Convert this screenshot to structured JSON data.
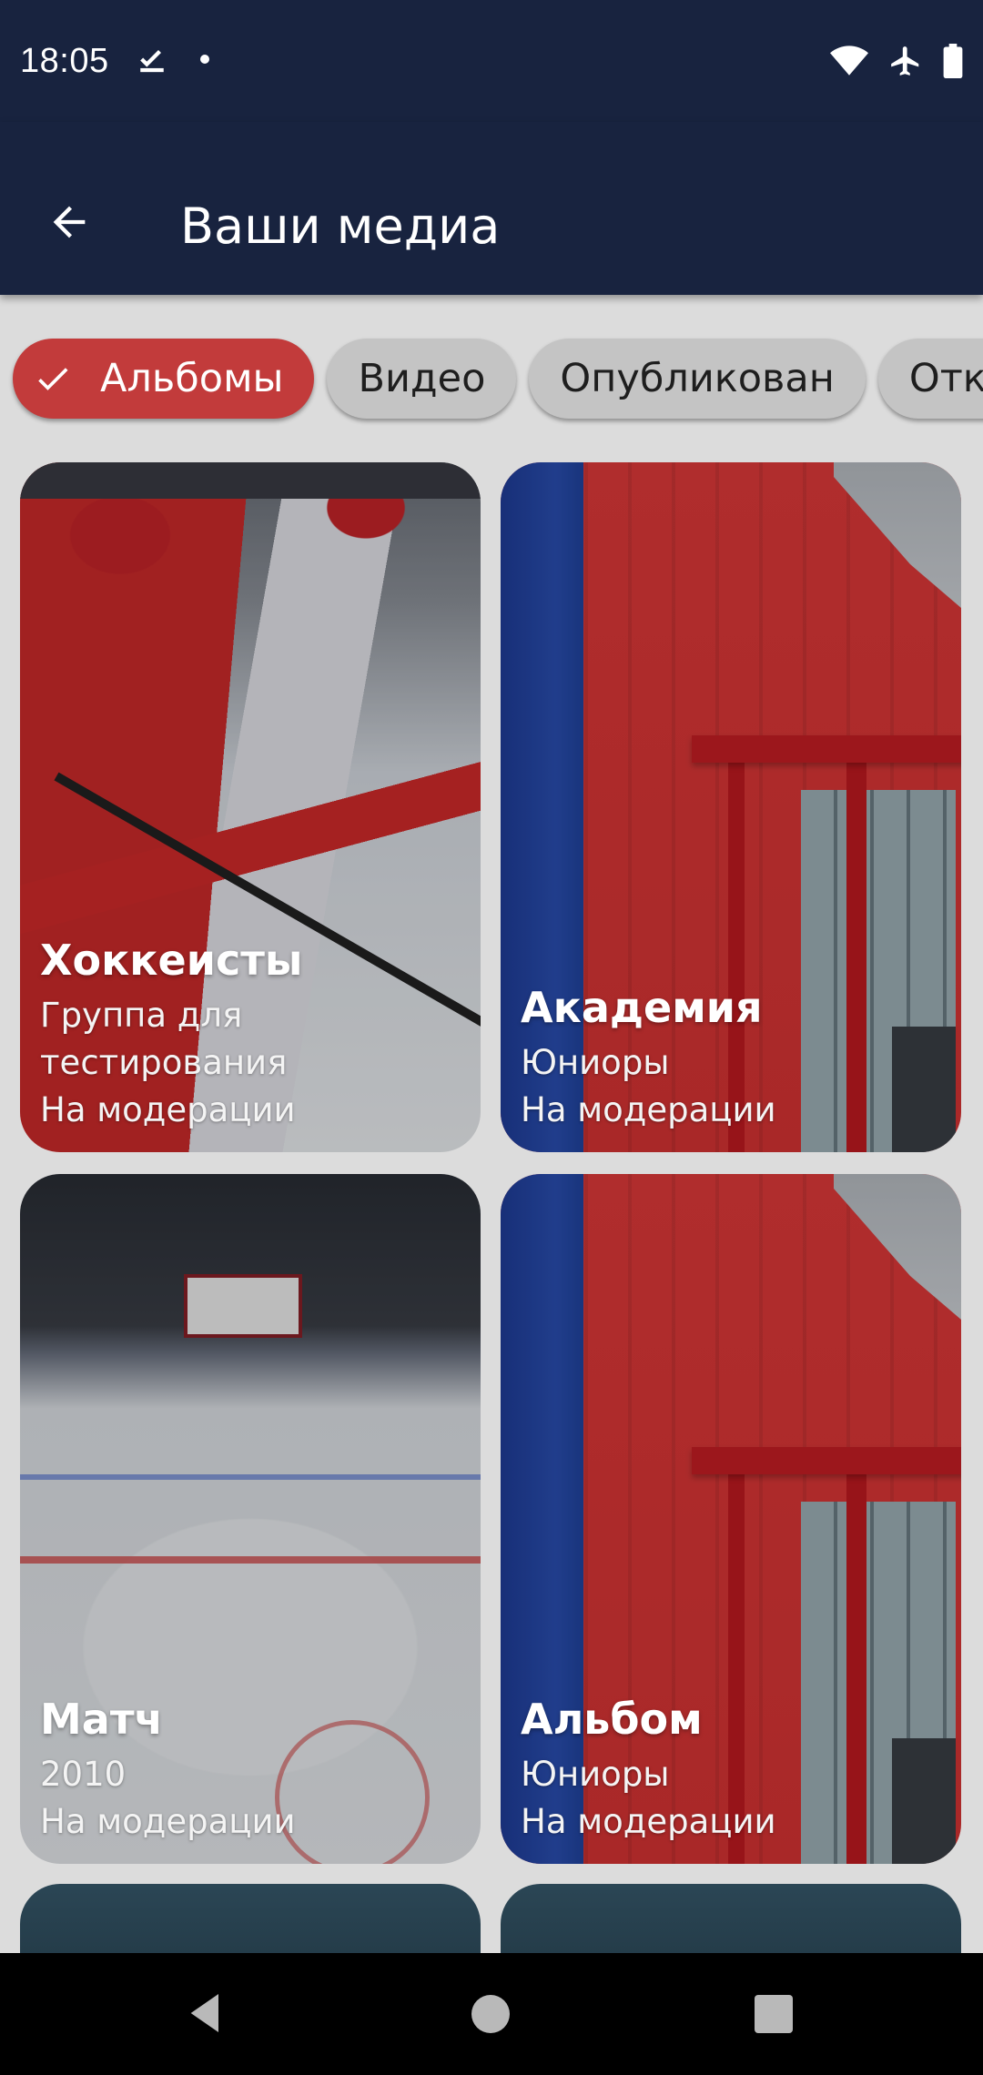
{
  "status_bar": {
    "time": "18:05",
    "left_icons": [
      "download-done-icon",
      "dot-icon"
    ],
    "right_icons": [
      "wifi-icon",
      "airplane-icon",
      "battery-icon"
    ]
  },
  "app_bar": {
    "title": "Ваши медиа",
    "back_icon": "arrow-back-icon"
  },
  "filters": {
    "chips": [
      {
        "label": "Альбомы",
        "selected": true
      },
      {
        "label": "Видео",
        "selected": false
      },
      {
        "label": "Опубликован",
        "selected": false
      },
      {
        "label": "Откл",
        "selected": false
      }
    ]
  },
  "media": {
    "cards": [
      {
        "title": "Хоккеисты",
        "subtitle": "Группа для тестирования",
        "status": "На модерации"
      },
      {
        "title": "Академия",
        "subtitle": "Юниоры",
        "status": "На модерации"
      },
      {
        "title": "Матч",
        "subtitle": "2010",
        "status": "На модерации"
      },
      {
        "title": "Альбом",
        "subtitle": "Юниоры",
        "status": "На модерации"
      }
    ]
  },
  "colors": {
    "primary": "#18233f",
    "accent": "#c23b3b",
    "chip_bg": "#c4c4c4",
    "background": "#dcdcdc"
  }
}
